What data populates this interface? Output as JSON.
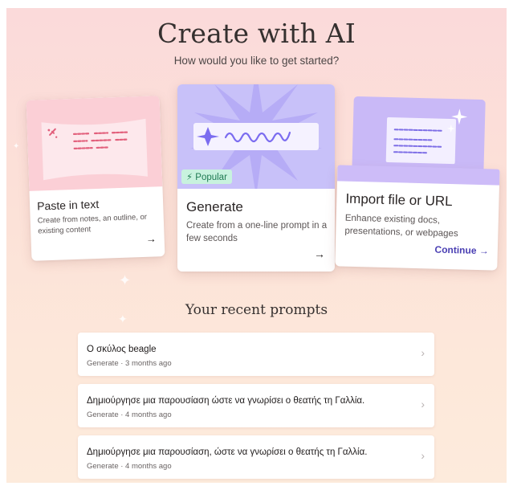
{
  "header": {
    "title": "Create with AI",
    "subtitle": "How would you like to get started?"
  },
  "cards": {
    "paste": {
      "title": "Paste in text",
      "description": "Create from notes, an outline, or existing content",
      "arrow": "→"
    },
    "generate": {
      "badge": "⚡ Popular",
      "title": "Generate",
      "description": "Create from a one-line prompt in a few seconds",
      "arrow": "→"
    },
    "import": {
      "title": "Import file or URL",
      "description": "Enhance existing docs, presentations, or webpages",
      "continue_label": "Continue →"
    }
  },
  "recent": {
    "title": "Your recent prompts",
    "items": [
      {
        "title": "Ο σκύλος beagle",
        "meta": "Generate · 3 months ago"
      },
      {
        "title": "Δημιούργησε μια παρουσίαση ώστε να γνωρίσει ο θεατής τη Γαλλία.",
        "meta": "Generate · 4 months ago"
      },
      {
        "title": "Δημιούργησε μια παρουσίαση, ώστε να γνωρίσει ο θεατής τη Γαλλία.",
        "meta": "Generate · 4 months ago"
      }
    ]
  },
  "icons": {
    "chevron": "›",
    "sparkle": "✦"
  },
  "colors": {
    "accent": "#4a3fb3",
    "badge_bg": "#c8f2de",
    "badge_text": "#1e7a52",
    "paste_art": "#fbcfd6",
    "generate_art": "#c8c1f9",
    "import_folder": "#c9b9f7"
  }
}
